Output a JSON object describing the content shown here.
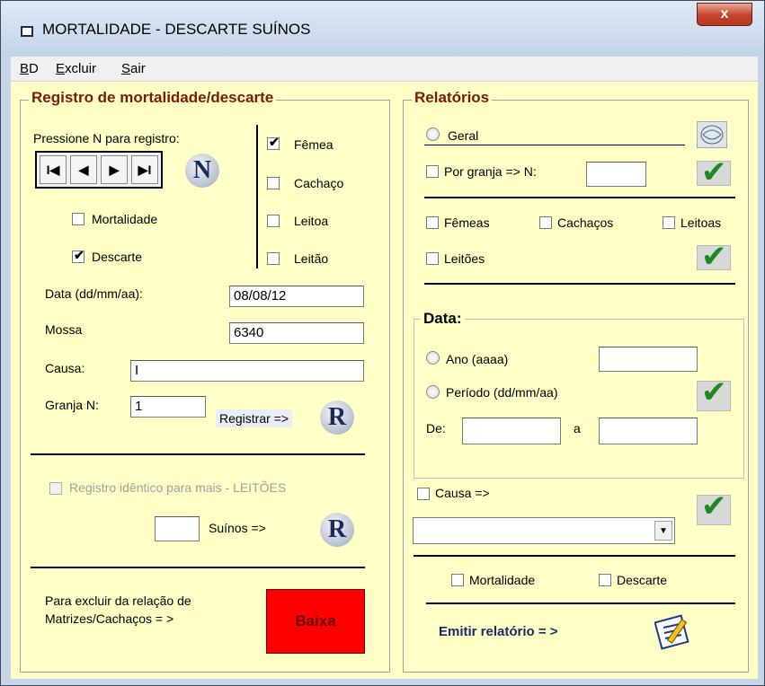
{
  "window": {
    "title": "MORTALIDADE - DESCARTE  SUÍNOS",
    "close_label": "x"
  },
  "menu": [
    {
      "key": "B",
      "rest": "D"
    },
    {
      "key": "E",
      "rest": "xcluir"
    },
    {
      "key": "S",
      "rest": "air"
    }
  ],
  "registro": {
    "title": "Registro de mortalidade/descarte",
    "prompt": "Pressione N para registro:",
    "nav": {
      "first": "I◀",
      "prev": "◀",
      "next": "▶",
      "last": "▶I"
    },
    "n_button": "N",
    "mortalidade_label": "Mortalidade",
    "mortalidade_checked": false,
    "descarte_label": "Descarte",
    "descarte_checked": true,
    "tipo": [
      {
        "label": "Fêmea",
        "checked": true
      },
      {
        "label": "Cachaço",
        "checked": false
      },
      {
        "label": "Leitoa",
        "checked": false
      },
      {
        "label": "Leitão",
        "checked": false
      }
    ],
    "data_label": "Data (dd/mm/aa):",
    "data_value": "08/08/12",
    "mossa_label": "Mossa",
    "mossa_value": "6340",
    "causa_label": "Causa:",
    "causa_value": "I",
    "granja_label": "Granja N:",
    "granja_value": "1",
    "registrar_label": "Registrar =>",
    "r_button": "R",
    "identico_label": "Registro idêntico para mais -  LEITÕES",
    "suinos_label": "Suínos =>",
    "suinos_value": "",
    "excluir_text_1": "Para excluir da relação de",
    "excluir_text_2": "Matrizes/Cachaços = >",
    "baixa_label": "Baixa"
  },
  "relatorios": {
    "title": "Relatórios",
    "geral_label": "Geral",
    "por_granja_label": "Por granja => N:",
    "por_granja_value": "",
    "femeas_label": "Fêmeas",
    "cachacos_label": "Cachaços",
    "leitoas_label": "Leitoas",
    "leitoes_label": "Leitões",
    "data_title": "Data:",
    "ano_label": "Ano (aaaa)",
    "ano_value": "",
    "periodo_label": "Período (dd/mm/aa)",
    "de_label": "De:",
    "de_value": "",
    "a_label": "a",
    "a_value": "",
    "causa_label": "Causa =>",
    "causa_select_value": "",
    "mortalidade_label": "Mortalidade",
    "descarte_label": "Descarte",
    "emitir_label": "Emitir relatório = >"
  },
  "colors": {
    "panel": "#ffffc6",
    "legend_red": "#7a1a0a",
    "baixa": "#ff0000",
    "check_green": "#1e8a1e"
  }
}
